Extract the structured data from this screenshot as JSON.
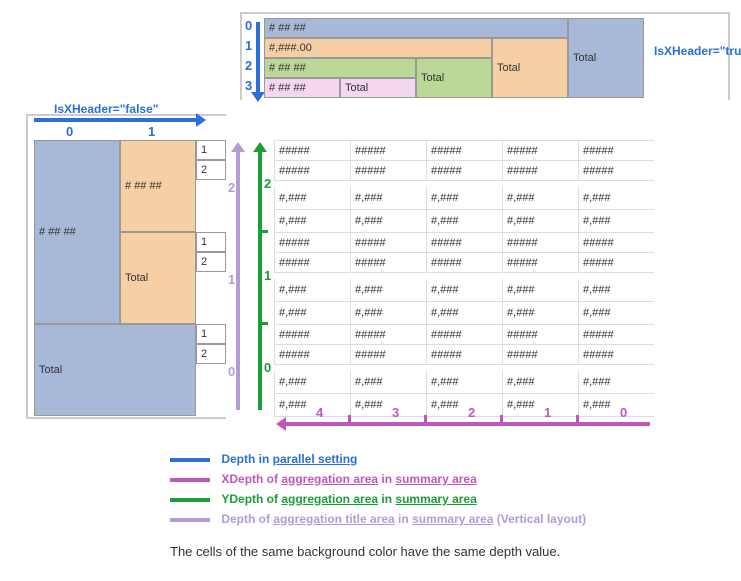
{
  "xheader": {
    "depth_labels": [
      "0",
      "1",
      "2",
      "3"
    ],
    "rows": [
      {
        "depth": "0",
        "cells": [
          {
            "t": "# ## ##",
            "cls": "c-blue",
            "span": 4
          }
        ]
      },
      {
        "depth": "1",
        "cells": [
          {
            "t": "#,###.00",
            "cls": "c-peach",
            "span": 3
          },
          {
            "t": "Total",
            "cls": "c-peach",
            "span": 1,
            "tall": 2
          }
        ]
      },
      {
        "depth": "2",
        "cells": [
          {
            "t": "# ## ##",
            "cls": "c-green",
            "span": 2
          },
          {
            "t": "Total",
            "cls": "c-green",
            "span": 1,
            "tall": 2
          }
        ]
      },
      {
        "depth": "3",
        "cells": [
          {
            "t": "# ## ##",
            "cls": "c-pink",
            "span": 1
          },
          {
            "t": "Total",
            "cls": "c-pink",
            "span": 1
          }
        ]
      }
    ],
    "total_right": "Total",
    "tag": "IsXHeader=\"true\""
  },
  "yheader": {
    "depth_labels": [
      "0",
      "1"
    ],
    "col0": [
      {
        "t": "# ## ##",
        "cls": "c-blue"
      },
      {
        "t": "Total",
        "cls": "c-blue"
      }
    ],
    "col1": [
      {
        "t": "# ## ##",
        "cls": "c-peach"
      },
      {
        "t": "Total",
        "cls": "c-peach"
      }
    ],
    "col2_groups": [
      [
        "1",
        "2"
      ],
      [
        "1",
        "2"
      ],
      [
        "1",
        "2"
      ]
    ],
    "tag": "IsXHeader=\"false\""
  },
  "agg_title_depths": [
    "2",
    "1",
    "0"
  ],
  "ydepth_labels": [
    "2",
    "1",
    "0"
  ],
  "xdepth_labels": [
    "4",
    "3",
    "2",
    "1",
    "0"
  ],
  "data": {
    "pattern_hash": "#####",
    "pattern_comma": "#,###",
    "cols": 5,
    "blocks": [
      [
        "h",
        "h",
        "c",
        "c"
      ],
      [
        "h",
        "h",
        "c",
        "c"
      ],
      [
        "h",
        "h",
        "c",
        "c"
      ]
    ]
  },
  "legend": {
    "l1": {
      "color": "#2b6fd8",
      "pre": "Depth in ",
      "u1": "parallel setting",
      "post": ""
    },
    "l2": {
      "color": "#c257bb",
      "pre": "XDepth of ",
      "u1": "aggregation area",
      "mid": " in ",
      "u2": "summary area"
    },
    "l3": {
      "color": "#1a9e36",
      "pre": "YDepth of ",
      "u1": "aggregation area",
      "mid": " in ",
      "u2": "summary area"
    },
    "l4": {
      "color": "#b39bd8",
      "pre": "Depth of ",
      "u1": "aggregation title area",
      "mid": " in ",
      "u2": "summary area",
      "post": " (Vertical layout)"
    }
  },
  "footer": "The cells of the same background color have the same depth value."
}
